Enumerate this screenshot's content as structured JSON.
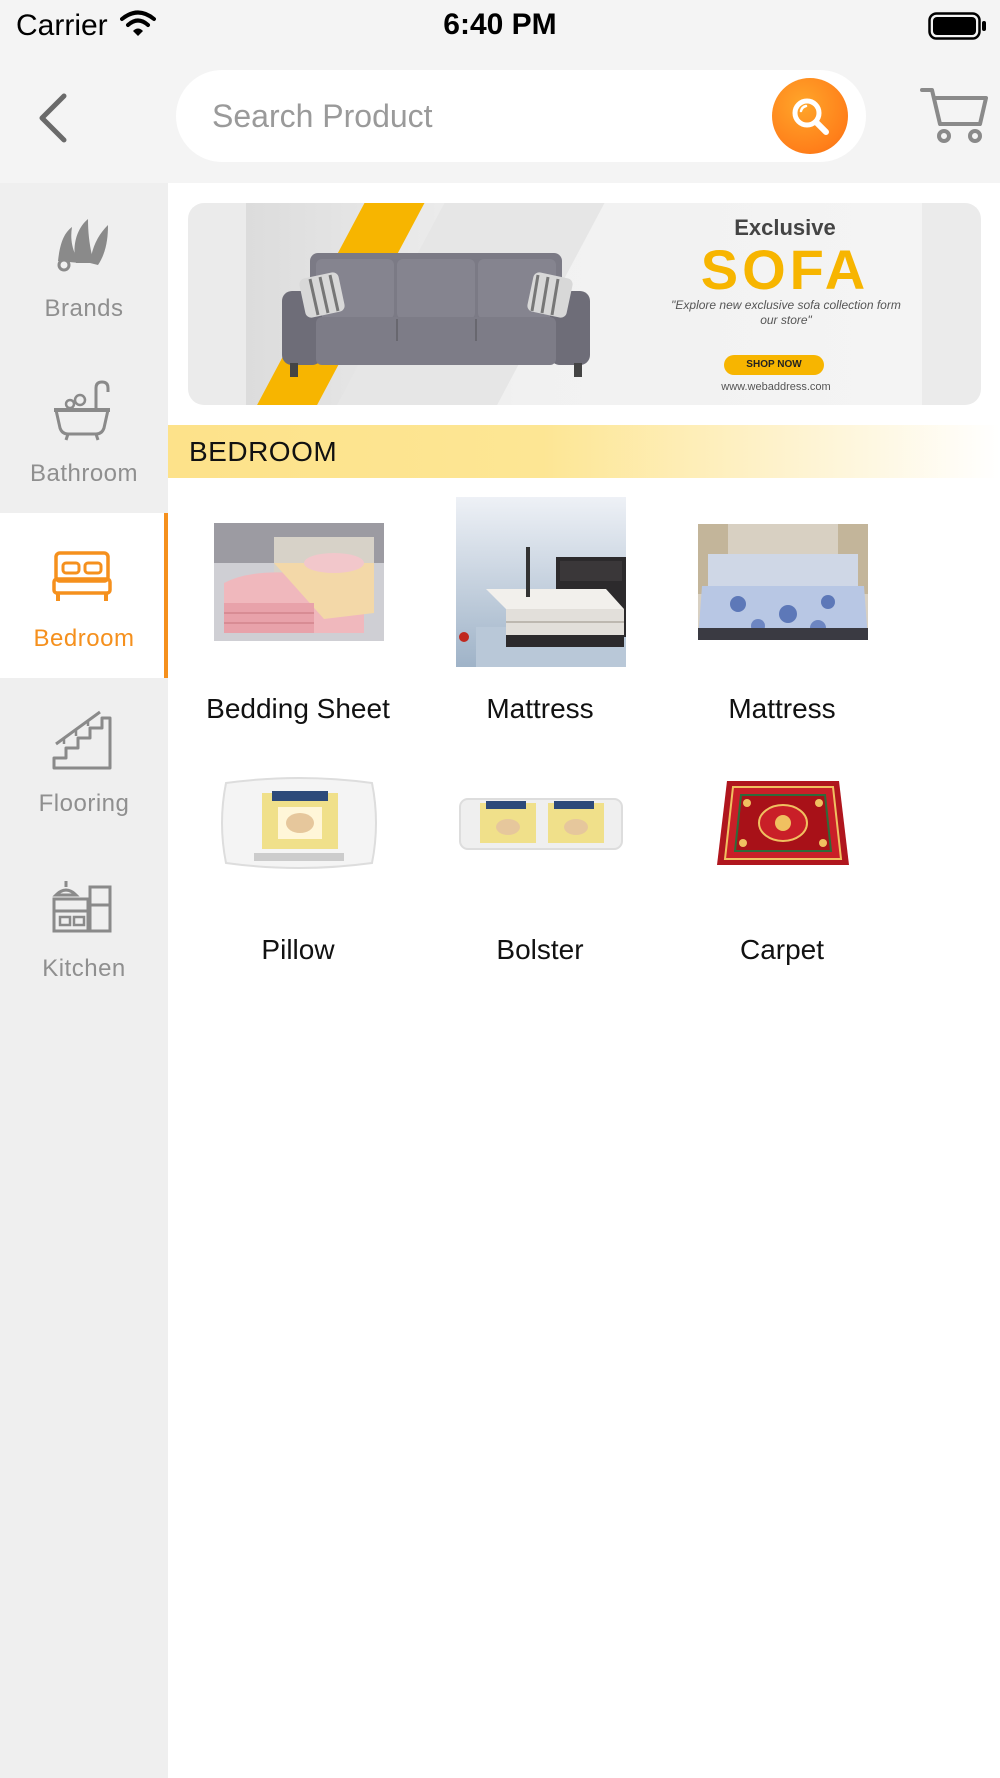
{
  "status_bar": {
    "carrier": "Carrier",
    "time": "6:40 PM"
  },
  "header": {
    "search_placeholder": "Search Product",
    "search_value": ""
  },
  "sidebar": {
    "items": [
      {
        "label": "Brands",
        "icon": "brands-icon",
        "active": false
      },
      {
        "label": "Bathroom",
        "icon": "bathtub-icon",
        "active": false
      },
      {
        "label": "Bedroom",
        "icon": "bed-icon",
        "active": true
      },
      {
        "label": "Flooring",
        "icon": "stairs-icon",
        "active": false
      },
      {
        "label": "Kitchen",
        "icon": "kitchen-icon",
        "active": false
      }
    ]
  },
  "banner": {
    "heading": "Exclusive",
    "title": "SOFA",
    "tagline": "\"Explore new exclusive sofa collection form our store\"",
    "cta": "SHOP NOW",
    "url": "www.webaddress.com"
  },
  "section": {
    "title": "BEDROOM"
  },
  "products": [
    {
      "name": "Bedding Sheet",
      "image": "bedding-sheet-image"
    },
    {
      "name": "Mattress",
      "image": "mattress-image"
    },
    {
      "name": "Mattress",
      "image": "mattress-bed-image"
    },
    {
      "name": "Pillow",
      "image": "pillow-image"
    },
    {
      "name": "Bolster",
      "image": "bolster-image"
    },
    {
      "name": "Carpet",
      "image": "carpet-image"
    }
  ],
  "colors": {
    "accent": "#f5901d",
    "sidebar_bg": "#efefef",
    "section_bar": "#fde28a",
    "banner_yellow": "#f7b500"
  }
}
